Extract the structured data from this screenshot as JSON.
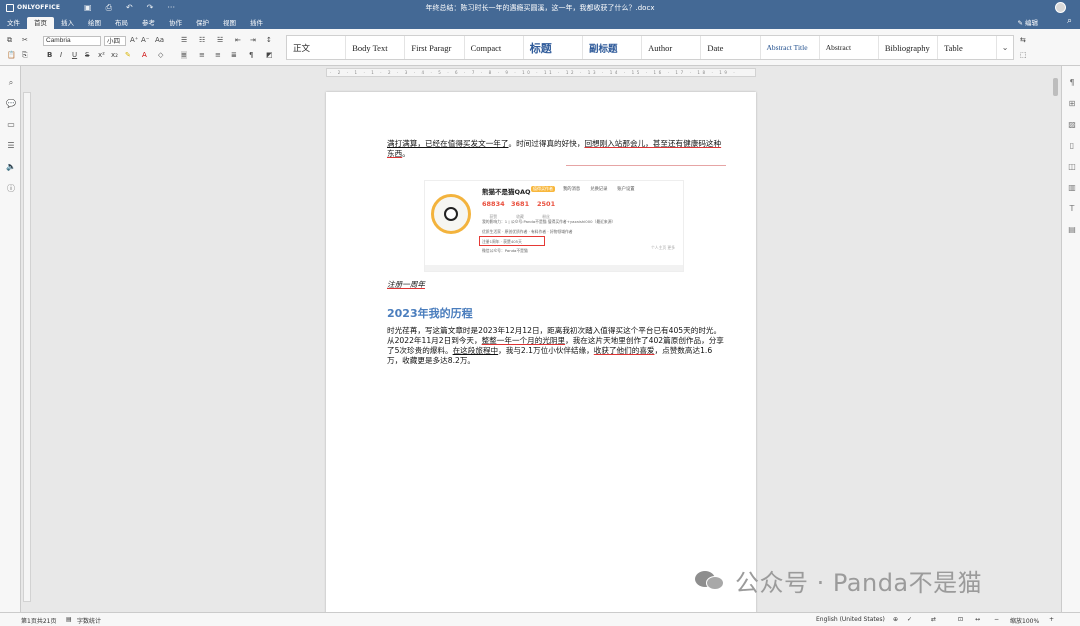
{
  "app": {
    "name": "ONLYOFFICE",
    "doc_title": "年终总结：陈习时长一年的遇瘾买圆溪，这一年，我都收获了什么？.docx"
  },
  "quick_access": {
    "more": "···"
  },
  "menu": {
    "tabs": [
      "文件",
      "首页",
      "插入",
      "绘图",
      "布局",
      "参考",
      "协作",
      "保护",
      "视图",
      "插件"
    ],
    "active": "首页",
    "edit_mode": "编辑"
  },
  "toolbar": {
    "font_name": "Cambria",
    "font_size": "小四",
    "styles": [
      {
        "label": "正文",
        "kind": "plain"
      },
      {
        "label": "Body Text",
        "kind": "serif"
      },
      {
        "label": "First Paragr",
        "kind": "serif"
      },
      {
        "label": "Compact",
        "kind": "serif"
      },
      {
        "label": "标题",
        "kind": "heading"
      },
      {
        "label": "副标题",
        "kind": "sub"
      },
      {
        "label": "Author",
        "kind": "serif"
      },
      {
        "label": "Date",
        "kind": "serif"
      },
      {
        "label": "Abstract Title",
        "kind": "abs-title"
      },
      {
        "label": "Abstract",
        "kind": "abs"
      },
      {
        "label": "Bibliography",
        "kind": "serif"
      },
      {
        "label": "Table",
        "kind": "serif"
      }
    ]
  },
  "ruler": {
    "marks": "· 2 · 1 · 1 · 2 · 3 · 4 · 5 · 6 · 7 · 8 · 9 · 10 · 11 · 12 · 13 · 14 · 15 · 16 · 17 · 18 · 19 ·"
  },
  "document": {
    "para1_a": "满打满算，已经在值得买发文一年了",
    "para1_b": "。时间过得真的好快，",
    "para1_c": "回想刚入站那会儿，甚至还有健康码这种东西",
    "para1_d": "。",
    "image": {
      "name": "熊猫不是猫QAQ",
      "badge": "值得买作者",
      "tabs": [
        "我的消息",
        "兑换记录",
        "账户设置"
      ],
      "stats": [
        {
          "value": "68834",
          "label": "获赞"
        },
        {
          "value": "3681",
          "label": "收藏"
        },
        {
          "value": "2501",
          "label": "粉丝"
        }
      ],
      "line1": "我的影响力：1 | 公众号:Panda不是猫 值得买作者+yazaishi000（最近来源）",
      "line2": "优质生活家 · 原创优质作者 · 有料作者 · 好物领域作者",
      "line3": "注册1周年 · 获赞405天",
      "line4": "微信公众号：Panda不是猫",
      "foot": "个人主页    更多"
    },
    "caption": "注册一周年",
    "heading": "2023年我的历程",
    "para2_a": "时光荏苒，写这篇文章时是2023年12月12日，距离我初次踏入值得买这个平台已有405天的时光。从2022年11月2日到今天，",
    "para2_b": "整整一年一个月的光阴里",
    "para2_c": "，我在这片天地里创作了402篇原创作品，分享了5次珍贵的爆料。",
    "para2_d": "在这段旅程中",
    "para2_e": "，我与2.1万位小伙伴结缘，",
    "para2_f": "收获了他们的喜爱",
    "para2_g": "，点赞数高达1.6万，收藏更是多达8.2万。"
  },
  "watermark": {
    "text": "公众号 · Panda不是猫"
  },
  "status": {
    "page": "第1页共21页",
    "word_count": "字数统计",
    "language": "English (United States)",
    "zoom": "缩放100%"
  },
  "colors": {
    "brand": "#446995",
    "heading": "#4a7dbd",
    "highlight_box": "#e53935"
  }
}
